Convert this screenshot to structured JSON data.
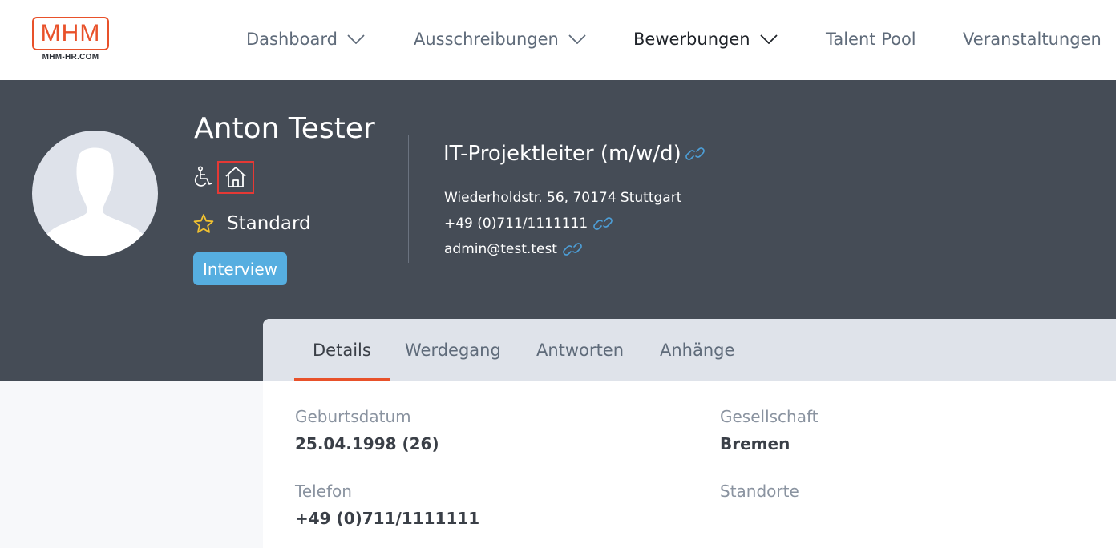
{
  "logo": {
    "text": "MHM",
    "subtext": "MHM-HR.COM"
  },
  "nav": {
    "items": [
      {
        "label": "Dashboard",
        "dropdown": true
      },
      {
        "label": "Ausschreibungen",
        "dropdown": true
      },
      {
        "label": "Bewerbungen",
        "dropdown": true,
        "active": true
      },
      {
        "label": "Talent Pool",
        "dropdown": false
      },
      {
        "label": "Veranstaltungen",
        "dropdown": false
      }
    ]
  },
  "candidate": {
    "name": "Anton Tester",
    "icons": [
      "wheelchair-icon",
      "home-icon"
    ],
    "rating_label": "Standard",
    "status": "Interview"
  },
  "job": {
    "title": "IT-Projektleiter (m/w/d)",
    "address": "Wiederholdstr. 56, 70174 Stuttgart",
    "phone": "+49 (0)711/1111111",
    "email": "admin@test.test"
  },
  "tabs": [
    "Details",
    "Werdegang",
    "Antworten",
    "Anhänge"
  ],
  "details": {
    "birthdate_label": "Geburtsdatum",
    "birthdate_value": "25.04.1998 (26)",
    "company_label": "Gesellschaft",
    "company_value": "Bremen",
    "phone_label": "Telefon",
    "phone_value": "+49 (0)711/1111111",
    "locations_label": "Standorte"
  },
  "colors": {
    "brand": "#e8512a",
    "header_bg": "#454c56",
    "badge": "#56aee0",
    "link": "#4d9fd8",
    "star": "#f2c230",
    "highlight": "#e53935"
  }
}
